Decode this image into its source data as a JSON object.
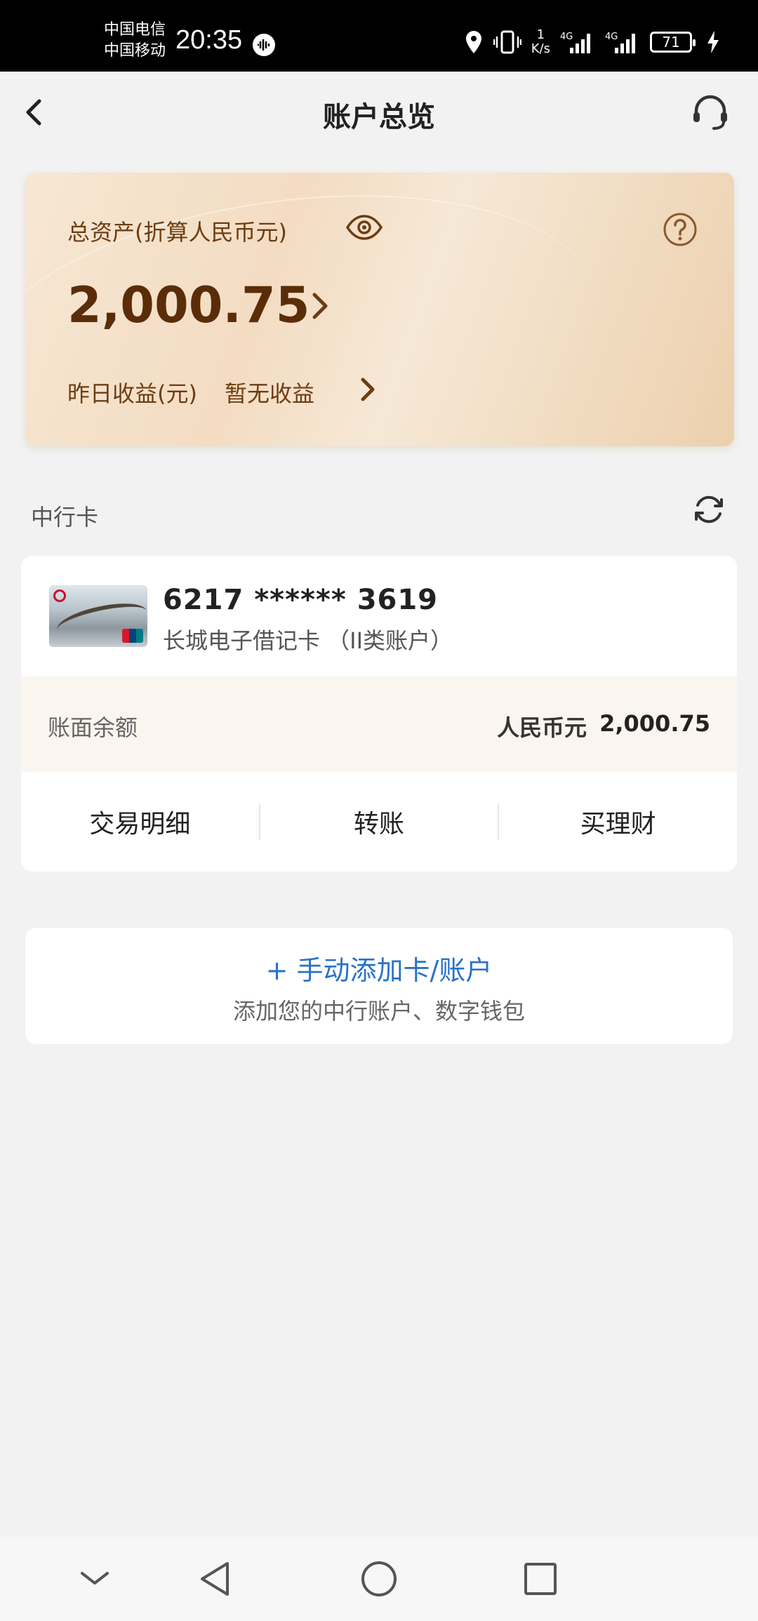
{
  "status_bar": {
    "carrier1": "中国电信",
    "carrier2": "中国移动",
    "time": "20:35",
    "net_speed_value": "1",
    "net_speed_unit": "K/s",
    "signal1": "4G",
    "signal2": "4G",
    "battery": "71"
  },
  "header": {
    "title": "账户总览"
  },
  "asset_card": {
    "label": "总资产(折算人民币元)",
    "amount": "2,000.75",
    "yield_label": "昨日收益(元)",
    "yield_value": "暂无收益"
  },
  "section": {
    "title": "中行卡"
  },
  "account": {
    "card_number": "6217 ****** 3619",
    "card_type": "长城电子借记卡 （II类账户）",
    "balance_label": "账面余额",
    "currency": "人民币元",
    "balance": "2,000.75",
    "actions": [
      "交易明细",
      "转账",
      "买理财"
    ]
  },
  "add_card": {
    "title": "+ 手动添加卡/账户",
    "subtitle": "添加您的中行账户、数字钱包"
  },
  "colors": {
    "accent_brown": "#5a2d08",
    "link_blue": "#2a72c8"
  }
}
